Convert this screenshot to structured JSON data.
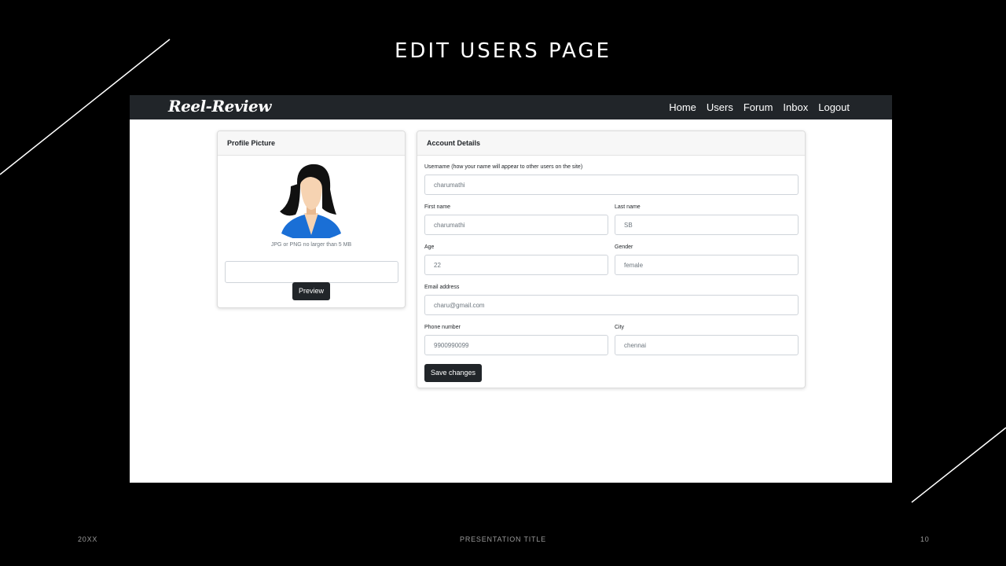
{
  "slide": {
    "title": "EDIT USERS PAGE",
    "footer_left": "20XX",
    "footer_center": "PRESENTATION TITLE",
    "footer_right": "10"
  },
  "app": {
    "brand": "Reel-Review",
    "nav": [
      "Home",
      "Users",
      "Forum",
      "Inbox",
      "Logout"
    ]
  },
  "profile_card": {
    "header": "Profile Picture",
    "hint": "JPG or PNG no larger than 5 MB",
    "file_input_value": "",
    "preview_label": "Preview"
  },
  "account_card": {
    "header": "Account Details",
    "username_label": "Username (how your name will appear to other users on the site)",
    "username_value": "charumathi",
    "first_name_label": "First name",
    "first_name_value": "charumathi",
    "last_name_label": "Last name",
    "last_name_value": "SB",
    "age_label": "Age",
    "age_value": "22",
    "gender_label": "Gender",
    "gender_value": "female",
    "email_label": "Email address",
    "email_value": "charu@gmail.com",
    "phone_label": "Phone number",
    "phone_value": "9900990099",
    "city_label": "City",
    "city_value": "chennai",
    "save_label": "Save changes"
  },
  "colors": {
    "navbar": "#212529",
    "button": "#212529",
    "background": "#000000",
    "avatar_shirt": "#1a6fd6",
    "avatar_hair": "#111111",
    "avatar_skin": "#f6d3b2"
  },
  "icons": {
    "avatar": "female-avatar-icon"
  }
}
